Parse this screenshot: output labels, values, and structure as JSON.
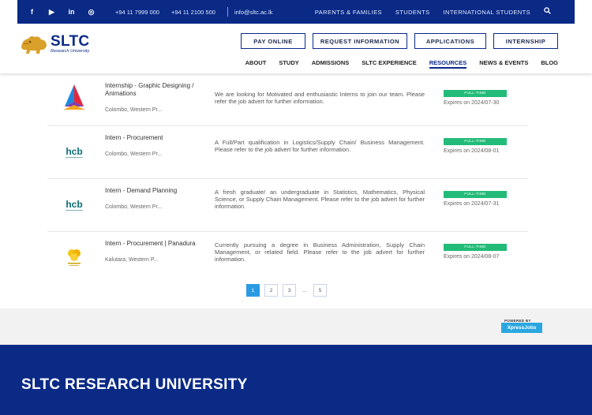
{
  "topbar": {
    "social": [
      {
        "icon": "facebook-icon",
        "glyph": "f"
      },
      {
        "icon": "youtube-icon",
        "glyph": "▶"
      },
      {
        "icon": "linkedin-icon",
        "glyph": "in"
      },
      {
        "icon": "instagram-icon",
        "glyph": "◎"
      }
    ],
    "phone1": "+94 11 7999 000",
    "phone2": "+94 11 2100 500",
    "email": "info@sltc.ac.lk",
    "links": [
      "PARENTS & FAMILIES",
      "STUDENTS",
      "INTERNATIONAL STUDENTS"
    ],
    "search_icon": "search-icon"
  },
  "header": {
    "logo_main": "SLTC",
    "logo_sub": "Research University",
    "buttons": [
      "PAY ONLINE",
      "REQUEST INFORMATION",
      "APPLICATIONS",
      "INTERNSHIP"
    ],
    "nav": [
      "ABOUT",
      "STUDY",
      "ADMISSIONS",
      "SLTC EXPERIENCE",
      "RESOURCES",
      "NEWS & EVENTS",
      "BLOG"
    ],
    "active_nav": "RESOURCES"
  },
  "jobs": [
    {
      "title": "Internship - Graphic Designing / Animations",
      "location": "Colombo, Western Pr...",
      "description": "We are looking for Motivated and enthusiastic Interns to join our team. Please refer the job advert for further information.",
      "type": "FULL-TIME",
      "expires": "Expires on 2024/07-30",
      "logo": "colorful-triangle-logo"
    },
    {
      "title": "Intern - Procurement",
      "location": "Colombo, Western Pr...",
      "description": "A Full/Part qualification in Logistics/Supply Chain/ Business Management. Please refer to the job advert for further information.",
      "type": "FULL-TIME",
      "expires": "Expires on 2024/08-01",
      "logo": "hcb-logo"
    },
    {
      "title": "Intern - Demand Planning",
      "location": "Colombo, Western Pr...",
      "description": "A fresh graduate/ an undergraduate in Statistics, Mathematics, Physical Science, or Supply Chain Management. Please refer to the job advert for further information.",
      "type": "FULL-TIME",
      "expires": "Expires on 2024/07-31",
      "logo": "hcb-logo"
    },
    {
      "title": "Intern - Procurement | Panadura",
      "location": "Kalutara, Western P...",
      "description": "Currently pursuing a degree in Business Administration, Supply Chain Management, or related field. Please refer to the job advert for further information.",
      "type": "FULL-TIME",
      "expires": "Expires on 2024/08-07",
      "logo": "yellow-flower-logo"
    }
  ],
  "pagination": {
    "pages": [
      "1",
      "2",
      "3",
      "...",
      "5"
    ],
    "current": "1"
  },
  "powered": {
    "label": "POWERED BY",
    "brand": "XpressJobs"
  },
  "footer": {
    "title": "SLTC RESEARCH UNIVERSITY"
  },
  "colors": {
    "navy": "#0a2a86",
    "badge_green": "#22bb77",
    "page_blue": "#2a9be3"
  }
}
